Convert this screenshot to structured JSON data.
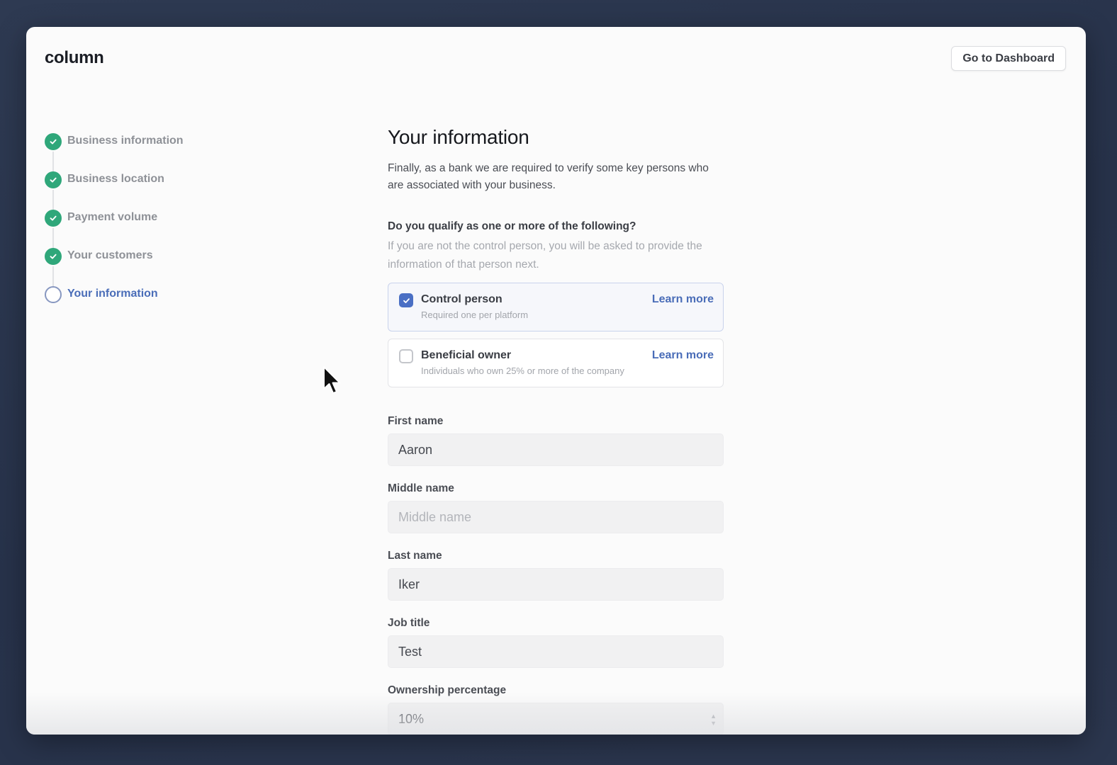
{
  "header": {
    "logo": "column",
    "dashboard_button": "Go to Dashboard"
  },
  "steps": [
    {
      "label": "Business information",
      "status": "done",
      "icon": "check-icon"
    },
    {
      "label": "Business location",
      "status": "done",
      "icon": "check-icon"
    },
    {
      "label": "Payment volume",
      "status": "done",
      "icon": "check-icon"
    },
    {
      "label": "Your customers",
      "status": "done",
      "icon": "check-icon"
    },
    {
      "label": "Your information",
      "status": "current",
      "icon": "circle-icon"
    }
  ],
  "main": {
    "title": "Your information",
    "intro": "Finally, as a bank we are required to verify some key persons who are associated with your business.",
    "question": "Do you qualify as one or more of the following?",
    "hint": "If you are not the control person, you will be asked to provide the information of that person next.",
    "options": [
      {
        "title": "Control person",
        "subtitle": "Required one per platform",
        "link": "Learn more",
        "checked": true
      },
      {
        "title": "Beneficial owner",
        "subtitle": "Individuals who own 25% or more of the company",
        "link": "Learn more",
        "checked": false
      }
    ],
    "fields": {
      "first_name": {
        "label": "First name",
        "value": "Aaron",
        "placeholder": ""
      },
      "middle_name": {
        "label": "Middle name",
        "value": "",
        "placeholder": "Middle name"
      },
      "last_name": {
        "label": "Last name",
        "value": "Iker",
        "placeholder": ""
      },
      "job_title": {
        "label": "Job title",
        "value": "Test",
        "placeholder": ""
      },
      "ownership": {
        "label": "Ownership percentage",
        "value": "10%",
        "placeholder": ""
      }
    }
  },
  "colors": {
    "accent": "#4a6db8",
    "success": "#2fa77a",
    "backdrop": "#2b364e"
  }
}
